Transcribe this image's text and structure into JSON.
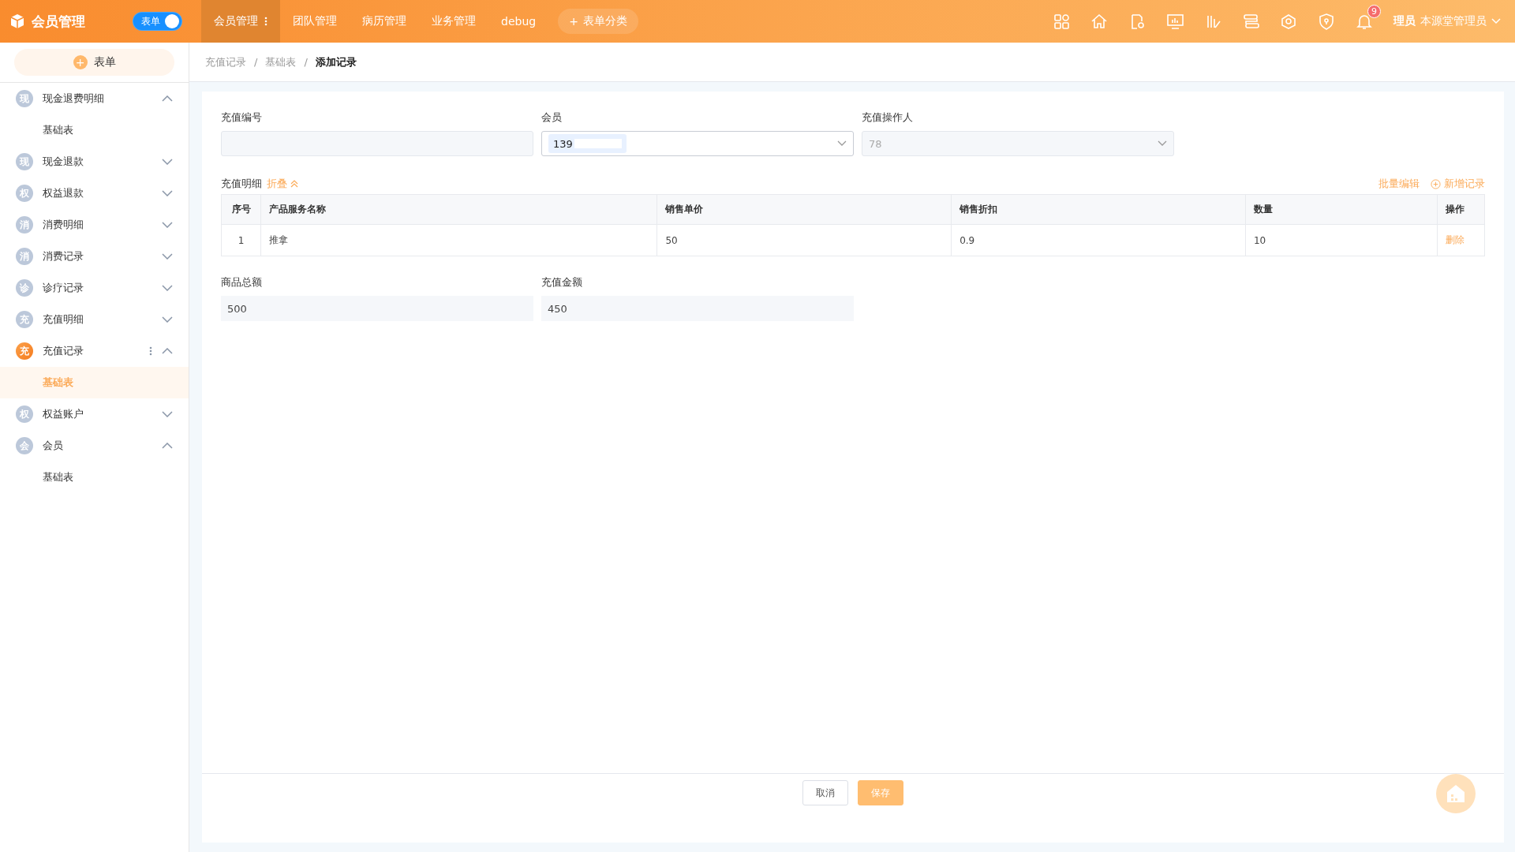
{
  "app": {
    "title": "会员管理"
  },
  "mode_switch": {
    "label": "表单",
    "on": true
  },
  "nav_tabs": [
    {
      "label": "会员管理",
      "selected": true,
      "has_menu": true
    },
    {
      "label": "团队管理",
      "selected": false,
      "has_menu": false
    },
    {
      "label": "病历管理",
      "selected": false,
      "has_menu": false
    },
    {
      "label": "业务管理",
      "selected": false,
      "has_menu": false
    },
    {
      "label": "debug",
      "selected": false,
      "has_menu": false
    }
  ],
  "add_category_button": {
    "icon": "+",
    "label": "表单分类"
  },
  "notification_count": "9",
  "user": {
    "role_fragment": "理员",
    "name": "本源堂管理员"
  },
  "sidebar": {
    "new_button": {
      "label": "表单"
    },
    "items": [
      {
        "badge": "现",
        "label": "现金退费明细",
        "expanded": true,
        "selected": false,
        "children": [
          {
            "label": "基础表",
            "selected": false
          }
        ]
      },
      {
        "badge": "现",
        "label": "现金退款",
        "expanded": false,
        "selected": false
      },
      {
        "badge": "权",
        "label": "权益退款",
        "expanded": false,
        "selected": false
      },
      {
        "badge": "消",
        "label": "消费明细",
        "expanded": false,
        "selected": false
      },
      {
        "badge": "消",
        "label": "消费记录",
        "expanded": false,
        "selected": false
      },
      {
        "badge": "诊",
        "label": "诊疗记录",
        "expanded": false,
        "selected": false
      },
      {
        "badge": "充",
        "label": "充值明细",
        "expanded": false,
        "selected": false
      },
      {
        "badge": "充",
        "label": "充值记录",
        "expanded": true,
        "selected": true,
        "children": [
          {
            "label": "基础表",
            "selected": true
          }
        ]
      },
      {
        "badge": "权",
        "label": "权益账户",
        "expanded": false,
        "selected": false
      },
      {
        "badge": "会",
        "label": "会员",
        "expanded": true,
        "selected": false,
        "children": [
          {
            "label": "基础表",
            "selected": false
          }
        ]
      }
    ]
  },
  "breadcrumb": {
    "separator": "/",
    "items": [
      "充值记录",
      "基础表",
      "添加记录"
    ]
  },
  "form": {
    "fields": [
      {
        "kind": "text",
        "label": "充值编号",
        "disabled": true
      },
      {
        "kind": "select",
        "label": "会员",
        "chip": "139",
        "disabled": false
      },
      {
        "kind": "select",
        "label": "充值操作人",
        "value": "78",
        "disabled": true
      }
    ],
    "detail": {
      "title": "充值明细",
      "collapse_link": "折叠",
      "batch_edit": "批量编辑",
      "add_record": "新增记录",
      "columns": [
        "序号",
        "产品服务名称",
        "销售单价",
        "销售折扣",
        "数量",
        "操作"
      ],
      "rows": [
        {
          "cells": [
            "1",
            "推拿",
            "50",
            "0.9",
            "10"
          ],
          "action": "删除"
        }
      ]
    },
    "totals": [
      {
        "label": "商品总额",
        "value": "500"
      },
      {
        "label": "充值金额",
        "value": "450"
      }
    ]
  },
  "footer": {
    "cancel": "取消",
    "save": "保存"
  }
}
